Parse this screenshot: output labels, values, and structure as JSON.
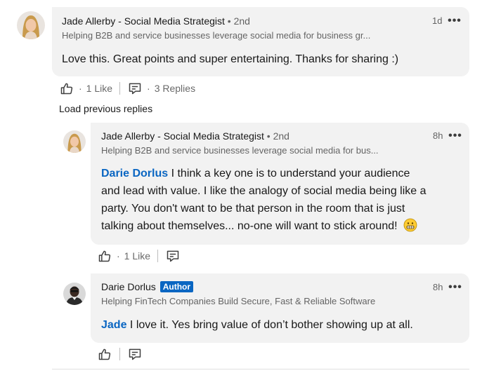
{
  "comments": [
    {
      "author": "Jade Allerby - Social Media Strategist",
      "degree": "• 2nd",
      "headline": "Helping B2B and service businesses leverage social media for business gr...",
      "time": "1d",
      "body": "Love this. Great points and super entertaining. Thanks for sharing :)",
      "likes": "1 Like",
      "replies": "3 Replies"
    }
  ],
  "load_previous": "Load previous replies",
  "replies": [
    {
      "author": "Jade Allerby - Social Media Strategist",
      "degree": "• 2nd",
      "headline": "Helping B2B and service businesses leverage social media for bus...",
      "time": "8h",
      "mention": "Darie Dorlus",
      "body_lines": [
        "I think a key one is to understand your audience",
        "and lead with value. I like the analogy of social media being like a",
        "party. You don't want to be that person in the room that is just",
        "talking about themselves... no-one will want to stick around!"
      ],
      "emoji": "grimacing-face",
      "likes": "1 Like"
    },
    {
      "author": "Darie Dorlus",
      "badge": "Author",
      "headline": "Helping FinTech Companies Build Secure, Fast & Reliable Software",
      "time": "8h",
      "mention": "Jade",
      "body": "I love it. Yes bring value of don’t bother showing up at all."
    }
  ],
  "dot": "·",
  "more_label": "•••",
  "icons": {
    "like": "like-icon",
    "reply": "reply-icon"
  },
  "colors": {
    "link": "#0a66c2",
    "bubble": "#f2f2f2",
    "badge": "#0a66c2"
  }
}
